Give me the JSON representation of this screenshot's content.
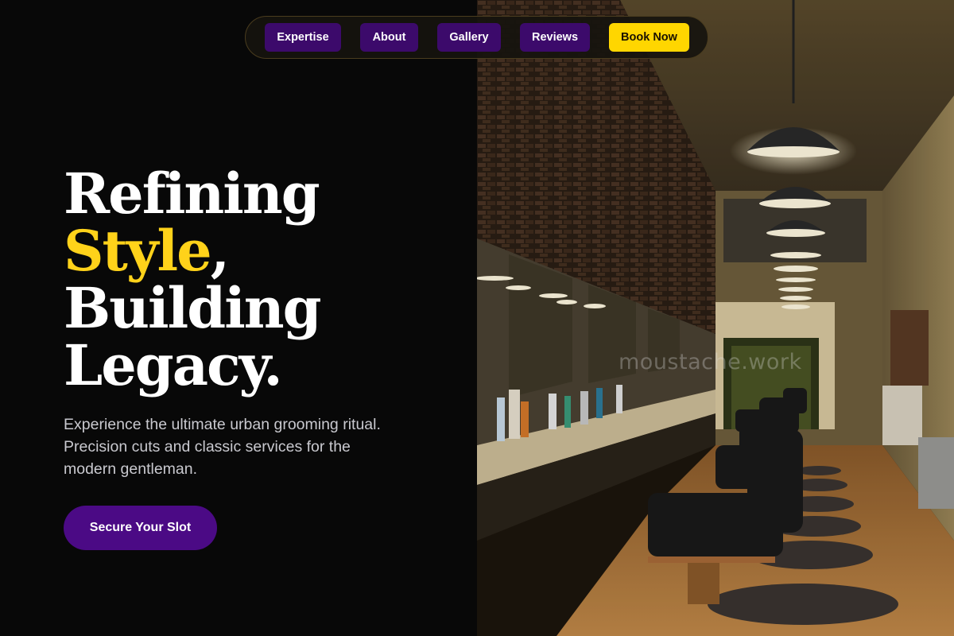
{
  "nav": {
    "items": [
      {
        "label": "Expertise"
      },
      {
        "label": "About"
      },
      {
        "label": "Gallery"
      },
      {
        "label": "Reviews"
      }
    ],
    "book_label": "Book Now"
  },
  "hero": {
    "headline": {
      "line1": "Refining",
      "line2_accent": "Style",
      "line2_rest": ",",
      "line3": "Building",
      "line4": "Legacy."
    },
    "subtext": [
      "Experience the ultimate urban grooming ritual.",
      "Precision cuts and classic services for the",
      "modern gentleman."
    ],
    "cta_label": "Secure Your Slot"
  },
  "photo": {
    "watermark": "moustache.work",
    "subject": "barbershop-interior"
  },
  "colors": {
    "background": "#080808",
    "accent_yellow": "#ffd21a",
    "accent_purple": "#4b0a85",
    "nav_button": "#3c0a6b",
    "book_button": "#ffd600"
  }
}
